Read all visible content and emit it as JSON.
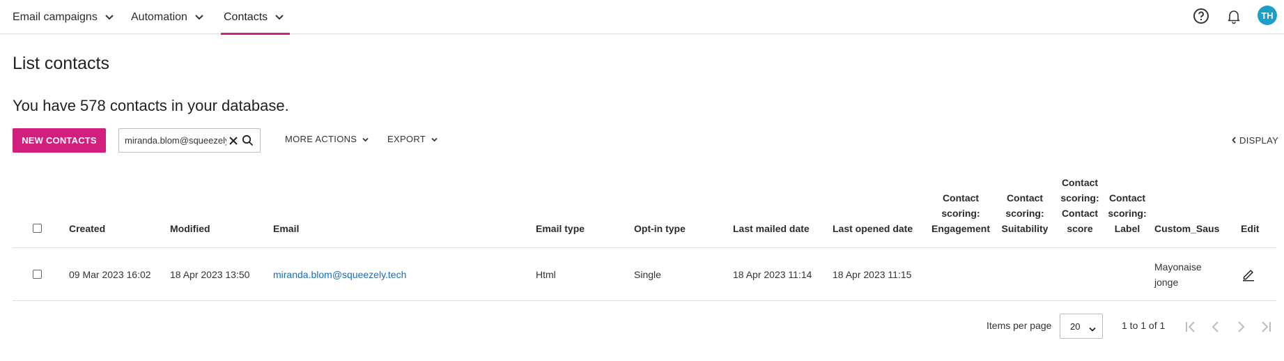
{
  "nav": {
    "items": [
      {
        "label": "Email campaigns"
      },
      {
        "label": "Automation"
      },
      {
        "label": "Contacts"
      }
    ],
    "avatar_initials": "TH"
  },
  "page": {
    "title": "List contacts",
    "summary": "You have 578 contacts in your database."
  },
  "toolbar": {
    "new_contacts_label": "NEW CONTACTS",
    "search_value": "miranda.blom@squeezely.tech",
    "more_actions_label": "MORE ACTIONS",
    "export_label": "EXPORT",
    "display_label": "DISPLAY"
  },
  "table": {
    "headers": {
      "created": "Created",
      "modified": "Modified",
      "email": "Email",
      "email_type": "Email type",
      "optin_type": "Opt-in type",
      "last_mailed": "Last mailed date",
      "last_opened": "Last opened date",
      "engagement": [
        "Contact",
        "scoring:",
        "Engagement"
      ],
      "suitability": [
        "Contact",
        "scoring:",
        "Suitability"
      ],
      "contact_score": [
        "Contact",
        "scoring:",
        "Contact",
        "score"
      ],
      "label": [
        "Contact",
        "scoring:",
        "Label"
      ],
      "custom_saus": "Custom_Saus",
      "edit": "Edit"
    },
    "rows": [
      {
        "created": "09 Mar 2023 16:02",
        "modified": "18 Apr 2023 13:50",
        "email": "miranda.blom@squeezely.tech",
        "email_type": "Html",
        "optin_type": "Single",
        "last_mailed": "18 Apr 2023 11:14",
        "last_opened": "18 Apr 2023 11:15",
        "engagement": "",
        "suitability": "",
        "contact_score": "",
        "label": "",
        "custom_saus": [
          "Mayonaise",
          "jonge"
        ]
      }
    ]
  },
  "paginator": {
    "items_per_page_label": "Items per page",
    "page_size": "20",
    "range_label": "1 to 1 of 1"
  },
  "colors": {
    "accent": "#d21e7c",
    "link": "#1a6dc0",
    "avatar": "#1aa0c8"
  }
}
